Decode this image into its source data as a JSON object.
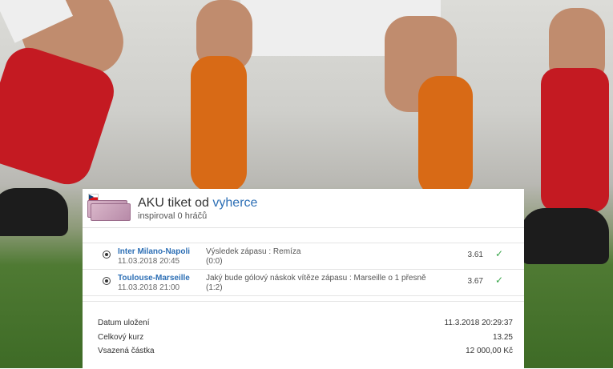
{
  "ticket": {
    "title_prefix": "AKU tiket od",
    "title_author": "vyherce",
    "inspired": "inspiroval 0 hráčů"
  },
  "bets": [
    {
      "match": "Inter Milano-Napoli",
      "datetime": "11.03.2018 20:45",
      "description": "Výsledek zápasu : Remíza",
      "score": "(0:0)",
      "odds": "3.61",
      "status_icon": "check-icon"
    },
    {
      "match": "Toulouse-Marseille",
      "datetime": "11.03.2018 21:00",
      "description": "Jaký bude gólový náskok vítěze zápasu : Marseille o 1 přesně",
      "score": "(1:2)",
      "odds": "3.67",
      "status_icon": "check-icon"
    }
  ],
  "summary": {
    "saved_label": "Datum uložení",
    "saved_value": "11.3.2018 20:29:37",
    "total_odds_label": "Celkový kurz",
    "total_odds_value": "13.25",
    "stake_label": "Vsazená částka",
    "stake_value": "12 000,00 Kč"
  },
  "colors": {
    "link": "#2d6fb5",
    "win_check": "#3aa64b"
  }
}
